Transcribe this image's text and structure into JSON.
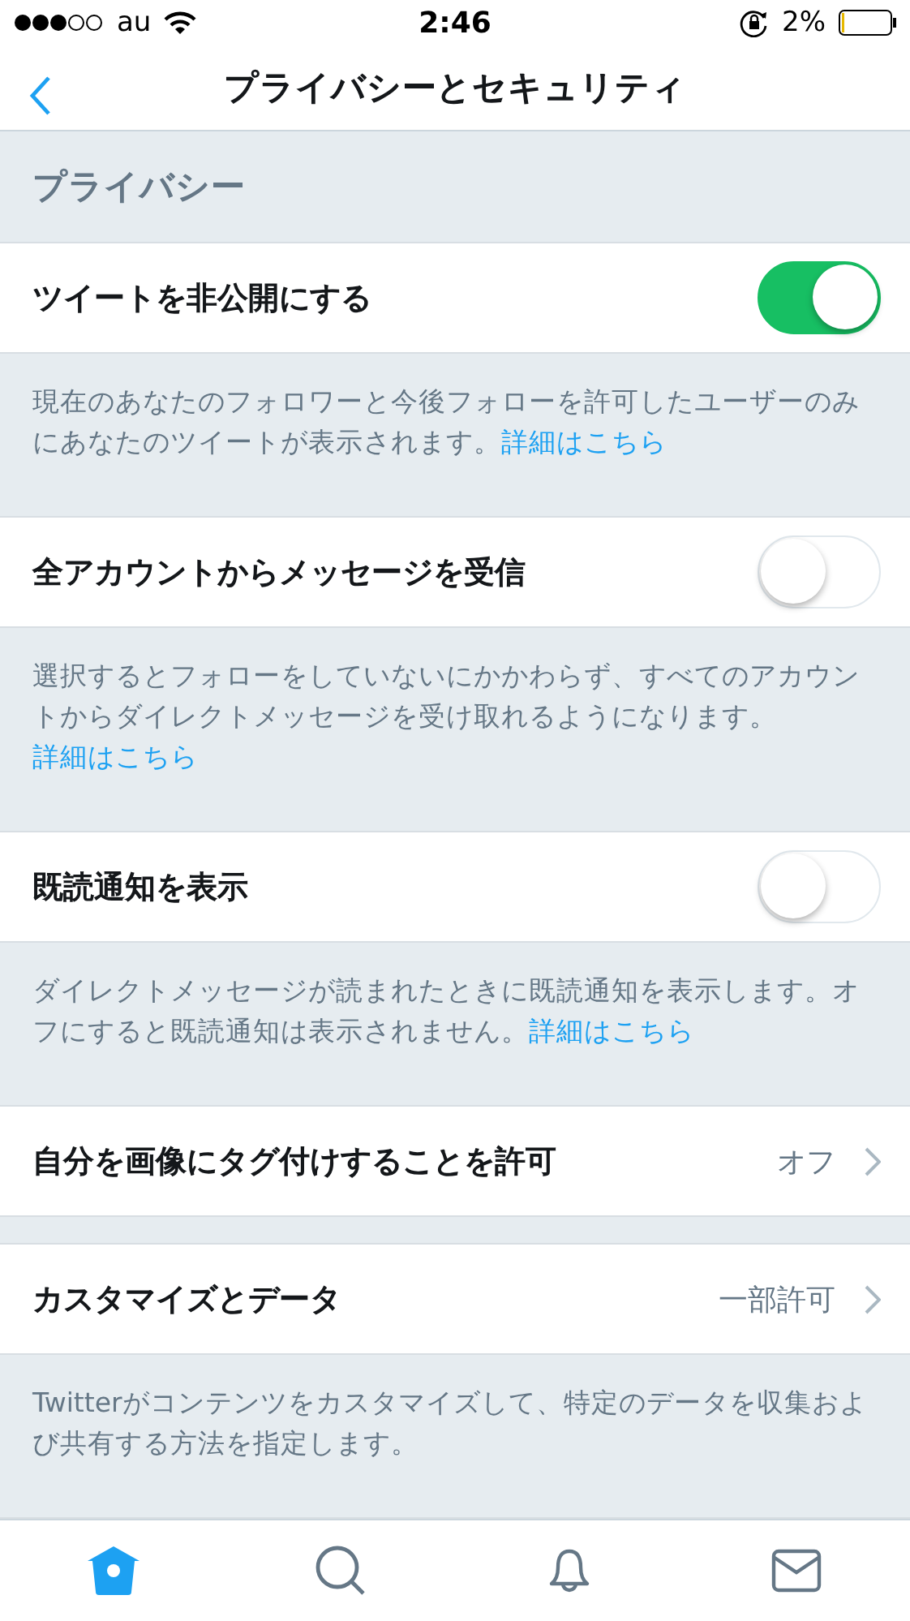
{
  "status_bar": {
    "carrier": "au",
    "time": "2:46",
    "battery": "2%"
  },
  "nav": {
    "title": "プライバシーとセキュリティ"
  },
  "section": {
    "title": "プライバシー"
  },
  "rows": [
    {
      "kind": "toggle",
      "label": "ツイートを非公開にする",
      "on": true,
      "description": "現在のあなたのフォロワーと今後フォローを許可したユーザーのみにあなたのツイートが表示されます。",
      "link": "詳細はこちら"
    },
    {
      "kind": "toggle",
      "label": "全アカウントからメッセージを受信",
      "on": false,
      "description": "選択するとフォローをしていないにかかわらず、すべてのアカウントからダイレクトメッセージを受け取れるようになります。",
      "link": "詳細はこちら"
    },
    {
      "kind": "toggle",
      "label": "既読通知を表示",
      "on": false,
      "description": "ダイレクトメッセージが読まれたときに既読通知を表示します。オフにすると既読通知は表示されません。",
      "link": "詳細はこちら"
    },
    {
      "kind": "nav",
      "label": "自分を画像にタグ付けすることを許可",
      "value": "オフ"
    },
    {
      "kind": "nav",
      "label": "カスタマイズとデータ",
      "value": "一部許可",
      "description": "Twitterがコンテンツをカスタマイズして、特定のデータを収集および共有する方法を指定します。"
    }
  ],
  "tabs": [
    {
      "selected": true
    },
    {
      "selected": false
    },
    {
      "selected": false
    },
    {
      "selected": false
    }
  ]
}
